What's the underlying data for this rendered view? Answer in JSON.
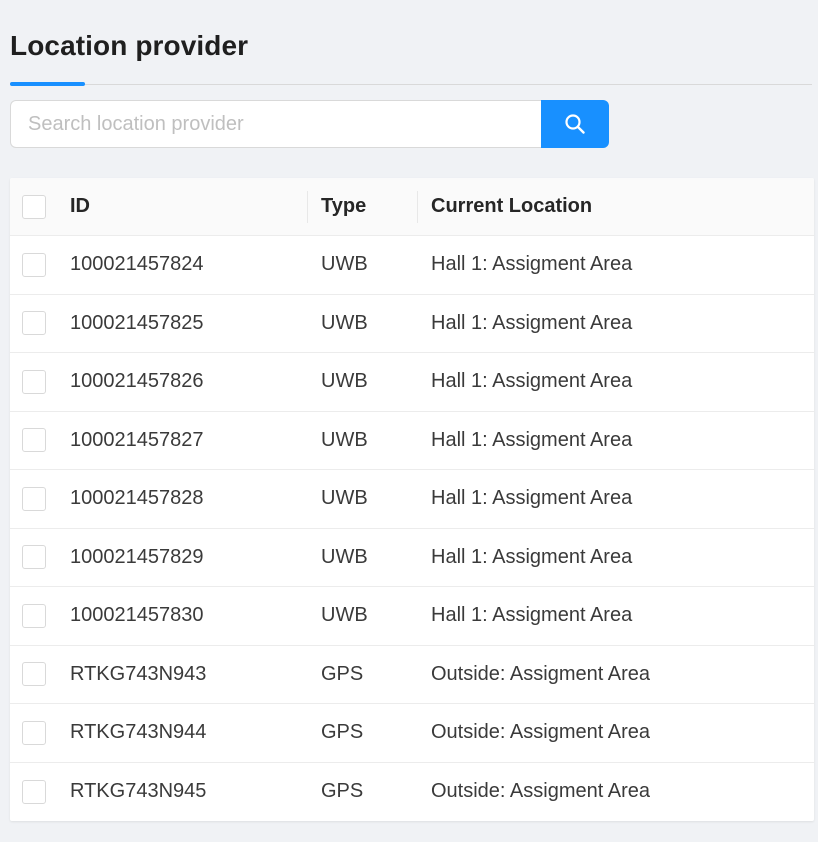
{
  "page": {
    "title": "Location provider"
  },
  "search": {
    "placeholder": "Search location provider",
    "button_icon": "search-icon"
  },
  "table": {
    "columns": {
      "id": "ID",
      "type": "Type",
      "location": "Current Location"
    },
    "rows": [
      {
        "id": "100021457824",
        "type": "UWB",
        "location": "Hall 1: Assigment Area"
      },
      {
        "id": "100021457825",
        "type": "UWB",
        "location": "Hall 1: Assigment Area"
      },
      {
        "id": "100021457826",
        "type": "UWB",
        "location": "Hall 1: Assigment Area"
      },
      {
        "id": "100021457827",
        "type": "UWB",
        "location": "Hall 1: Assigment Area"
      },
      {
        "id": "100021457828",
        "type": "UWB",
        "location": "Hall 1: Assigment Area"
      },
      {
        "id": "100021457829",
        "type": "UWB",
        "location": "Hall 1: Assigment Area"
      },
      {
        "id": "100021457830",
        "type": "UWB",
        "location": "Hall 1: Assigment Area"
      },
      {
        "id": "RTKG743N943",
        "type": "GPS",
        "location": "Outside: Assigment Area"
      },
      {
        "id": "RTKG743N944",
        "type": "GPS",
        "location": "Outside: Assigment Area"
      },
      {
        "id": "RTKG743N945",
        "type": "GPS",
        "location": "Outside: Assigment Area"
      }
    ]
  },
  "colors": {
    "accent": "#1890ff",
    "background": "#f0f2f5"
  }
}
